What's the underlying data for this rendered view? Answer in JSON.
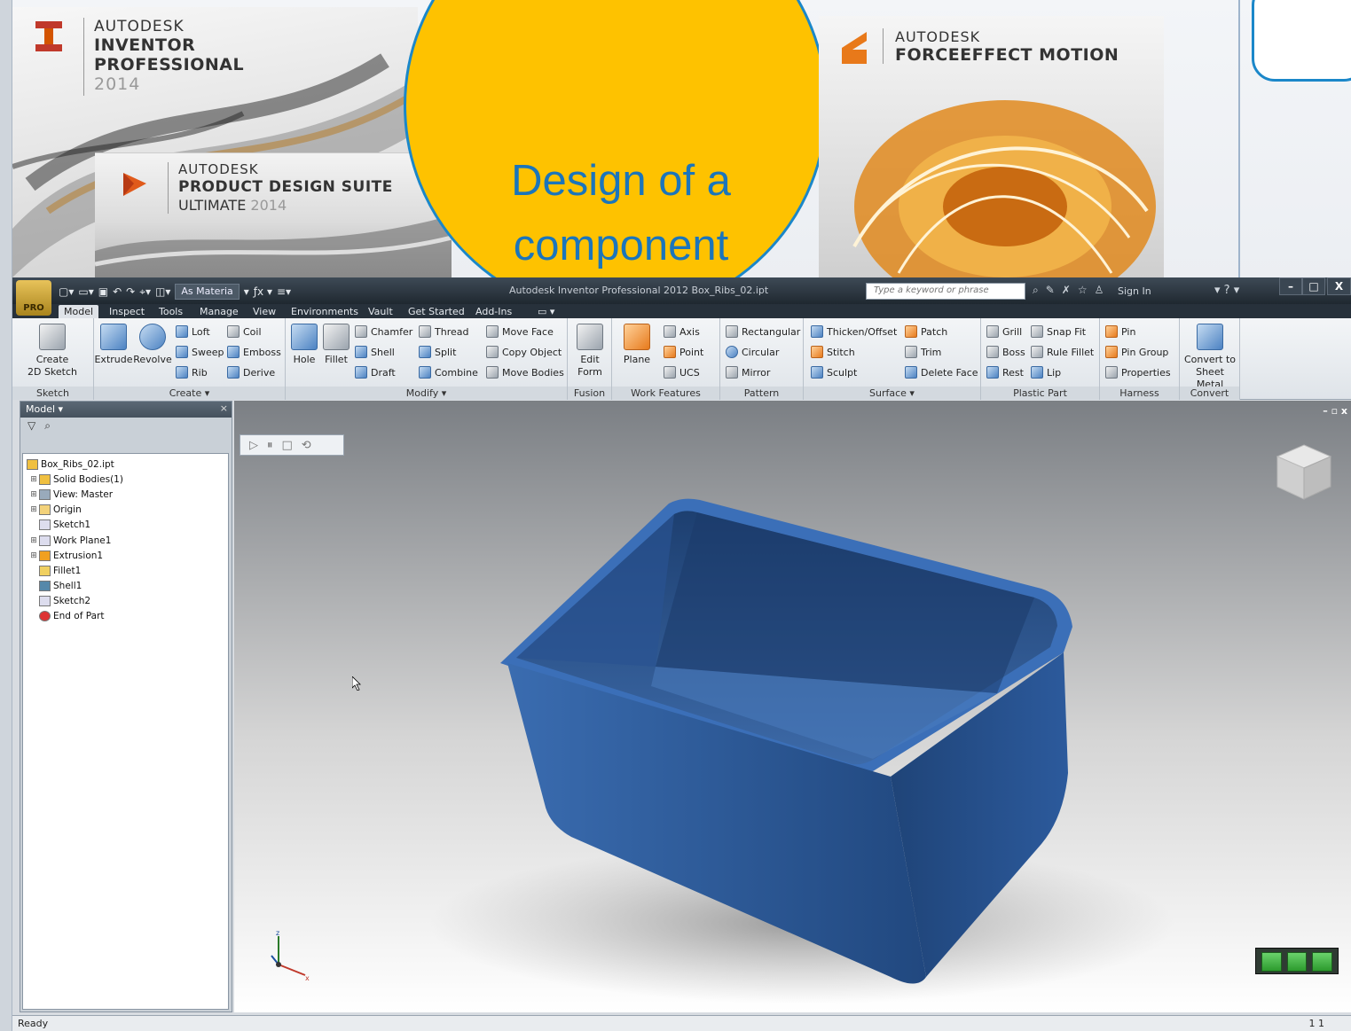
{
  "slide": {
    "circle_text_line1": "Design of a",
    "circle_text_line2": "component",
    "banners": {
      "inventor": {
        "brand": "AUTODESK",
        "product_line1": "INVENTOR",
        "product_line2": "PROFESSIONAL",
        "year": "2014"
      },
      "pds": {
        "brand": "AUTODESK",
        "product_line1": "PRODUCT DESIGN SUITE",
        "product_line2": "ULTIMATE",
        "year": "2014"
      },
      "force": {
        "brand": "AUTODESK",
        "product_line1": "FORCEEFFECT",
        "product_line2": "MOTION"
      }
    },
    "colors": {
      "circle_fill": "#fec200",
      "circle_stroke": "#1b87c9",
      "circle_text": "#1b75bb"
    }
  },
  "inventor": {
    "title": "Autodesk Inventor Professional 2012   Box_Ribs_02.ipt",
    "app_badge": "PRO",
    "material_select": "As Materia",
    "search_placeholder": "Type a keyword or phrase",
    "sign_in": "Sign In",
    "help": "?",
    "window_controls": {
      "minimize": "–",
      "maximize": "□",
      "close": "X"
    },
    "tabs": [
      "Model",
      "Inspect",
      "Tools",
      "Manage",
      "View",
      "Environments",
      "Vault",
      "Get Started",
      "Add-Ins"
    ],
    "ribbon": {
      "sketch": {
        "label": "Sketch",
        "create_2d_line1": "Create",
        "create_2d_line2": "2D Sketch"
      },
      "create": {
        "label": "Create ▾",
        "extrude": "Extrude",
        "revolve": "Revolve",
        "loft": "Loft",
        "sweep": "Sweep",
        "rib": "Rib",
        "coil": "Coil",
        "emboss": "Emboss",
        "derive": "Derive"
      },
      "modify": {
        "label": "Modify ▾",
        "hole": "Hole",
        "fillet": "Fillet",
        "chamfer": "Chamfer",
        "shell": "Shell",
        "draft": "Draft",
        "thread": "Thread",
        "split": "Split",
        "combine": "Combine",
        "move_face": "Move Face",
        "copy_object": "Copy Object",
        "move_bodies": "Move Bodies"
      },
      "fusion": {
        "label": "Fusion",
        "edit_form_line1": "Edit",
        "edit_form_line2": "Form"
      },
      "work_features": {
        "label": "Work Features",
        "plane": "Plane",
        "axis": "Axis",
        "point": "Point",
        "ucs": "UCS"
      },
      "pattern": {
        "label": "Pattern",
        "rectangular": "Rectangular",
        "circular": "Circular",
        "mirror": "Mirror"
      },
      "surface": {
        "label": "Surface ▾",
        "thicken": "Thicken/Offset",
        "stitch": "Stitch",
        "sculpt": "Sculpt",
        "patch": "Patch",
        "trim": "Trim",
        "delete_face": "Delete Face"
      },
      "plastic_part": {
        "label": "Plastic Part",
        "grill": "Grill",
        "boss": "Boss",
        "rest": "Rest",
        "snap_fit": "Snap Fit",
        "rule_fillet": "Rule Fillet",
        "lip": "Lip"
      },
      "harness": {
        "label": "Harness",
        "pin": "Pin",
        "pin_group": "Pin Group",
        "properties": "Properties"
      },
      "convert": {
        "label": "Convert",
        "convert_line1": "Convert to",
        "convert_line2": "Sheet Metal"
      }
    },
    "browser": {
      "title": "Model ▾",
      "items": [
        {
          "label": "Box_Ribs_02.ipt",
          "expander": ""
        },
        {
          "label": "Solid Bodies(1)",
          "expander": "⊞"
        },
        {
          "label": "View: Master",
          "expander": "⊞"
        },
        {
          "label": "Origin",
          "expander": "⊞"
        },
        {
          "label": "Sketch1",
          "expander": ""
        },
        {
          "label": "Work Plane1",
          "expander": "⊞"
        },
        {
          "label": "Extrusion1",
          "expander": "⊞"
        },
        {
          "label": "Fillet1",
          "expander": ""
        },
        {
          "label": "Shell1",
          "expander": ""
        },
        {
          "label": "Sketch2",
          "expander": ""
        },
        {
          "label": "End of Part",
          "expander": ""
        }
      ]
    },
    "status": {
      "left": "Ready",
      "right": "1    1"
    },
    "colors": {
      "part_blue": "#2c5a9c"
    }
  }
}
